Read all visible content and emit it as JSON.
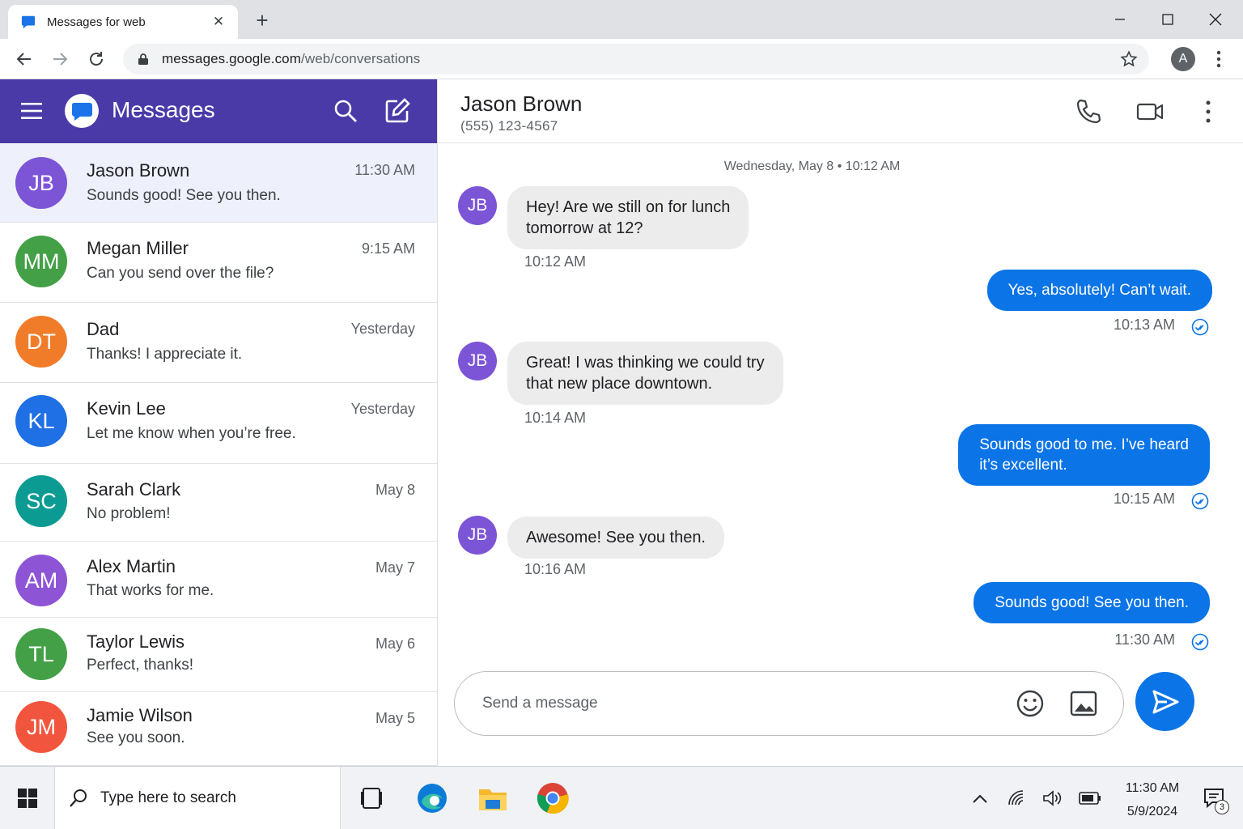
{
  "browser": {
    "tab_title": "Messages for web",
    "new_tab_label": "+",
    "url_domain": "messages.google.com",
    "url_path": "/web/conversations",
    "profile_initial": "A"
  },
  "sidebar": {
    "app_title": "Messages",
    "header_color": "#4a3aa8",
    "conversations": [
      {
        "initials": "JB",
        "name": "Jason Brown",
        "snippet": "Sounds good! See you then.",
        "time": "11:30 AM",
        "color": "#7c55d6",
        "active": true
      },
      {
        "initials": "MM",
        "name": "Megan Miller",
        "snippet": "Can you send over the file?",
        "time": "9:15 AM",
        "color": "#43a047"
      },
      {
        "initials": "DT",
        "name": "Dad",
        "snippet": "Thanks! I appreciate it.",
        "time": "Yesterday",
        "color": "#f07c2a"
      },
      {
        "initials": "KL",
        "name": "Kevin Lee",
        "snippet": "Let me know when you’re free.",
        "time": "Yesterday",
        "color": "#1f6fe5"
      },
      {
        "initials": "SC",
        "name": "Sarah Clark",
        "snippet": "No problem!",
        "time": "May 8",
        "color": "#0b9b93"
      },
      {
        "initials": "AM",
        "name": "Alex Martin",
        "snippet": "That works for me.",
        "time": "May 7",
        "color": "#8d55d6"
      },
      {
        "initials": "TL",
        "name": "Taylor Lewis",
        "snippet": "Perfect, thanks!",
        "time": "May 6",
        "color": "#43a047"
      },
      {
        "initials": "JM",
        "name": "Jamie Wilson",
        "snippet": "See you soon.",
        "time": "May 5",
        "color": "#f2553d"
      }
    ]
  },
  "chat": {
    "contact_name": "Jason Brown",
    "contact_phone": "(555) 123-4567",
    "date_separator": "Wednesday, May 8 • 10:12 AM",
    "messages": [
      {
        "direction": "in",
        "avatar": "JB",
        "lines": [
          "Hey! Are we still on for lunch",
          "tomorrow at 12?"
        ],
        "time": "10:12 AM"
      },
      {
        "direction": "out",
        "lines": [
          "Yes, absolutely! Can’t wait."
        ],
        "time": "10:13 AM"
      },
      {
        "direction": "in",
        "avatar": "JB",
        "lines": [
          "Great! I was thinking we could try",
          "that new place downtown."
        ],
        "time": "10:14 AM"
      },
      {
        "direction": "out",
        "lines": [
          "Sounds good to me. I’ve heard",
          "it’s excellent."
        ],
        "time": "10:15 AM"
      },
      {
        "direction": "in",
        "avatar": "JB",
        "lines": [
          "Awesome! See you then."
        ],
        "time": "10:16 AM"
      },
      {
        "direction": "out",
        "lines": [
          "Sounds good! See you then."
        ],
        "time": "11:30 AM"
      }
    ],
    "composer_placeholder": "Send a message",
    "accent_color": "#0b74e6"
  },
  "taskbar": {
    "search_placeholder": "Type here to search",
    "clock_time": "11:30 AM",
    "clock_date": "5/9/2024",
    "notification_count": "3"
  }
}
